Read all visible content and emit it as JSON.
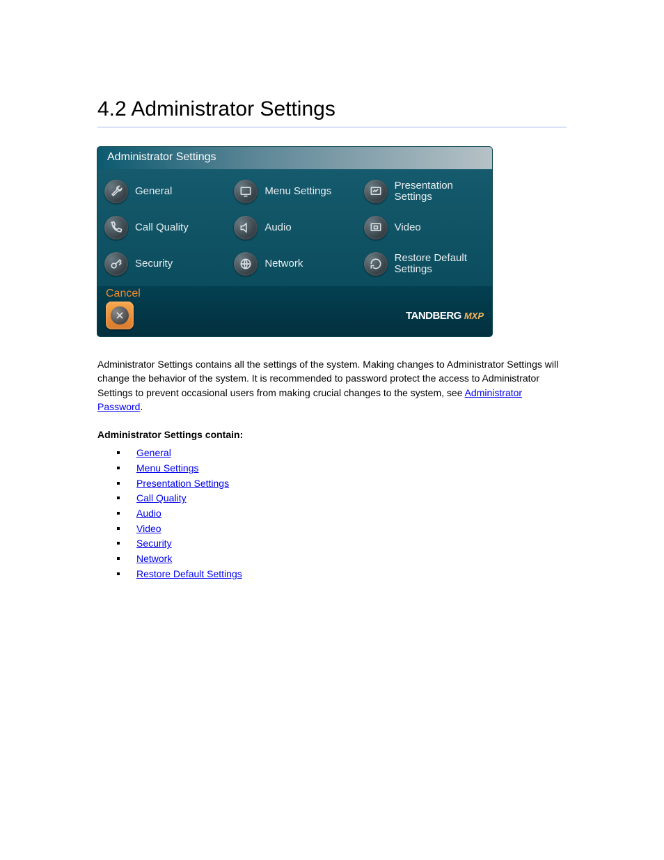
{
  "heading": "4.2 Administrator Settings",
  "panel": {
    "title": "Administrator Settings",
    "items": [
      {
        "label": "General",
        "icon": "wrench-icon"
      },
      {
        "label": "Menu Settings",
        "icon": "monitor-icon"
      },
      {
        "label": "Presentation Settings",
        "icon": "chart-icon"
      },
      {
        "label": "Call Quality",
        "icon": "phone-icon"
      },
      {
        "label": "Audio",
        "icon": "speaker-icon"
      },
      {
        "label": "Video",
        "icon": "camera-icon"
      },
      {
        "label": "Security",
        "icon": "key-icon"
      },
      {
        "label": "Network",
        "icon": "globe-icon"
      },
      {
        "label": "Restore Default Settings",
        "icon": "refresh-icon"
      }
    ],
    "cancel_label": "Cancel",
    "brand_main": "TANDBERG",
    "brand_sub": "MXP"
  },
  "para_before_link": "Administrator Settings contains all the settings of the system. Making changes to Administrator Settings will change the behavior of the system. It is recommended to password protect the access to Administrator Settings to prevent occasional users from making crucial changes to the system, see ",
  "para_link": "Administrator Password",
  "para_after_link": ".",
  "links_heading": "Administrator Settings contain:",
  "links": [
    "General",
    "Menu Settings",
    "Presentation Settings",
    "Call Quality",
    "Audio",
    "Video",
    "Security",
    "Network",
    "Restore Default Settings"
  ]
}
